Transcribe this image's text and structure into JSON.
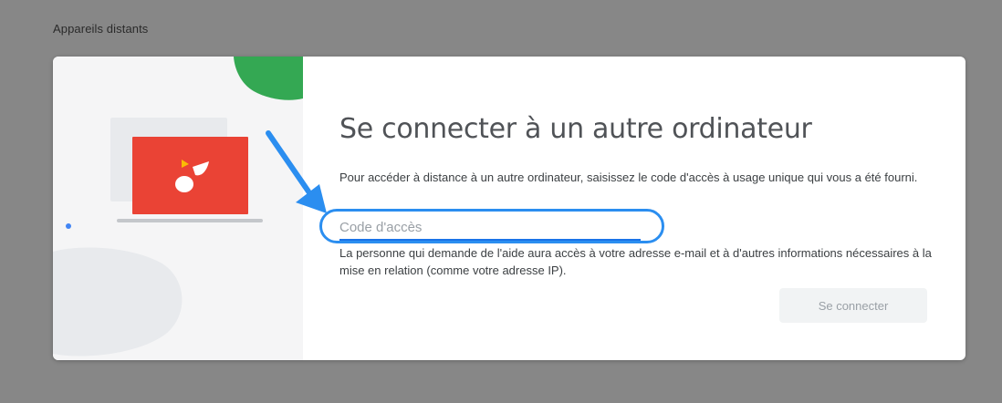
{
  "section": {
    "title": "Appareils distants"
  },
  "dialog": {
    "heading": "Se connecter à un autre ordinateur",
    "description": "Pour accéder à distance à un autre ordinateur, saisissez le code d'accès à usage unique qui vous a été fourni.",
    "code_input": {
      "placeholder": "Code d'accès",
      "value": ""
    },
    "hint": "La personne qui demande de l'aide aura accès à votre adresse e-mail et à d'autres informations nécessaires à la mise en relation (comme votre adresse IP).",
    "connect_label": "Se connecter"
  },
  "colors": {
    "backdrop": "#878787",
    "illustration_bg": "#f5f5f6",
    "laptop_screen": "#ea4335",
    "green_accent": "#34a853",
    "yellow_accent": "#fbbc04",
    "input_underline": "#1a73e8",
    "callout": "#2b8ef0"
  },
  "icons": {
    "illustration": "remote-desktop-laptop-illustration",
    "callout": "annotation-arrow-icon"
  }
}
